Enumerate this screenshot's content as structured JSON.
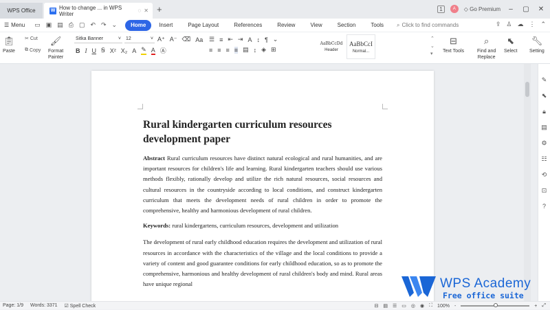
{
  "titlebar": {
    "app_tab": "WPS Office",
    "doc_tab": "How to change ... in WPS Writer",
    "new_tab": "+",
    "avatar": "A",
    "premium": "Go Premium"
  },
  "menubar": {
    "menu": "Menu",
    "tabs": [
      "Home",
      "Insert",
      "Page Layout",
      "References",
      "Review",
      "View",
      "Section",
      "Tools"
    ],
    "active_tab": "Home",
    "search_placeholder": "Click to find commands"
  },
  "ribbon": {
    "paste": "Paste",
    "cut": "Cut",
    "copy": "Copy",
    "format_painter_1": "Format",
    "format_painter_2": "Painter",
    "font_name": "Sitka Banner",
    "font_size": "12",
    "styles": [
      {
        "preview": "AaBbCcDd",
        "label": "Header"
      },
      {
        "preview": "AaBbCcI",
        "label": "Normal..."
      }
    ],
    "text_tools": "Text Tools",
    "find_replace_1": "Find and",
    "find_replace_2": "Replace",
    "select": "Select",
    "settings": "Setting"
  },
  "document": {
    "title": "Rural kindergarten curriculum resources development paper",
    "abstract_label": "Abstract",
    "abstract_text": " Rural curriculum resources have distinct natural ecological and rural humanities, and are important resources for children's life and learning. Rural kindergarten teachers should use various methods flexibly, rationally develop and utilize the rich natural resources, social resources and cultural resources in the countryside according to local conditions, and construct kindergarten curriculum that meets the development needs of rural children in order to promote the comprehensive, healthy and harmonious development of rural children.",
    "keywords_label": "Keywords:",
    "keywords_text": " rural kindergartens, curriculum resources, development and utilization",
    "body_text": "The development of rural early childhood education requires the development and utilization of rural resources in accordance with the characteristics of the village and the local conditions to provide a variety of content and good guarantee conditions for early childhood education, so as to promote the comprehensive, harmonious and healthy development of rural children's body and mind. Rural areas have unique regional"
  },
  "statusbar": {
    "page": "Page: 1/9",
    "words": "Words: 3371",
    "spell_check": "Spell Check",
    "zoom": "100%",
    "zoom_minus": "-",
    "zoom_plus": "+"
  },
  "watermark": {
    "title": "WPS Academy",
    "subtitle": "Free office suite tutorials"
  },
  "colors": {
    "accent": "#2d66e6",
    "watermark": "#1a66d6"
  }
}
